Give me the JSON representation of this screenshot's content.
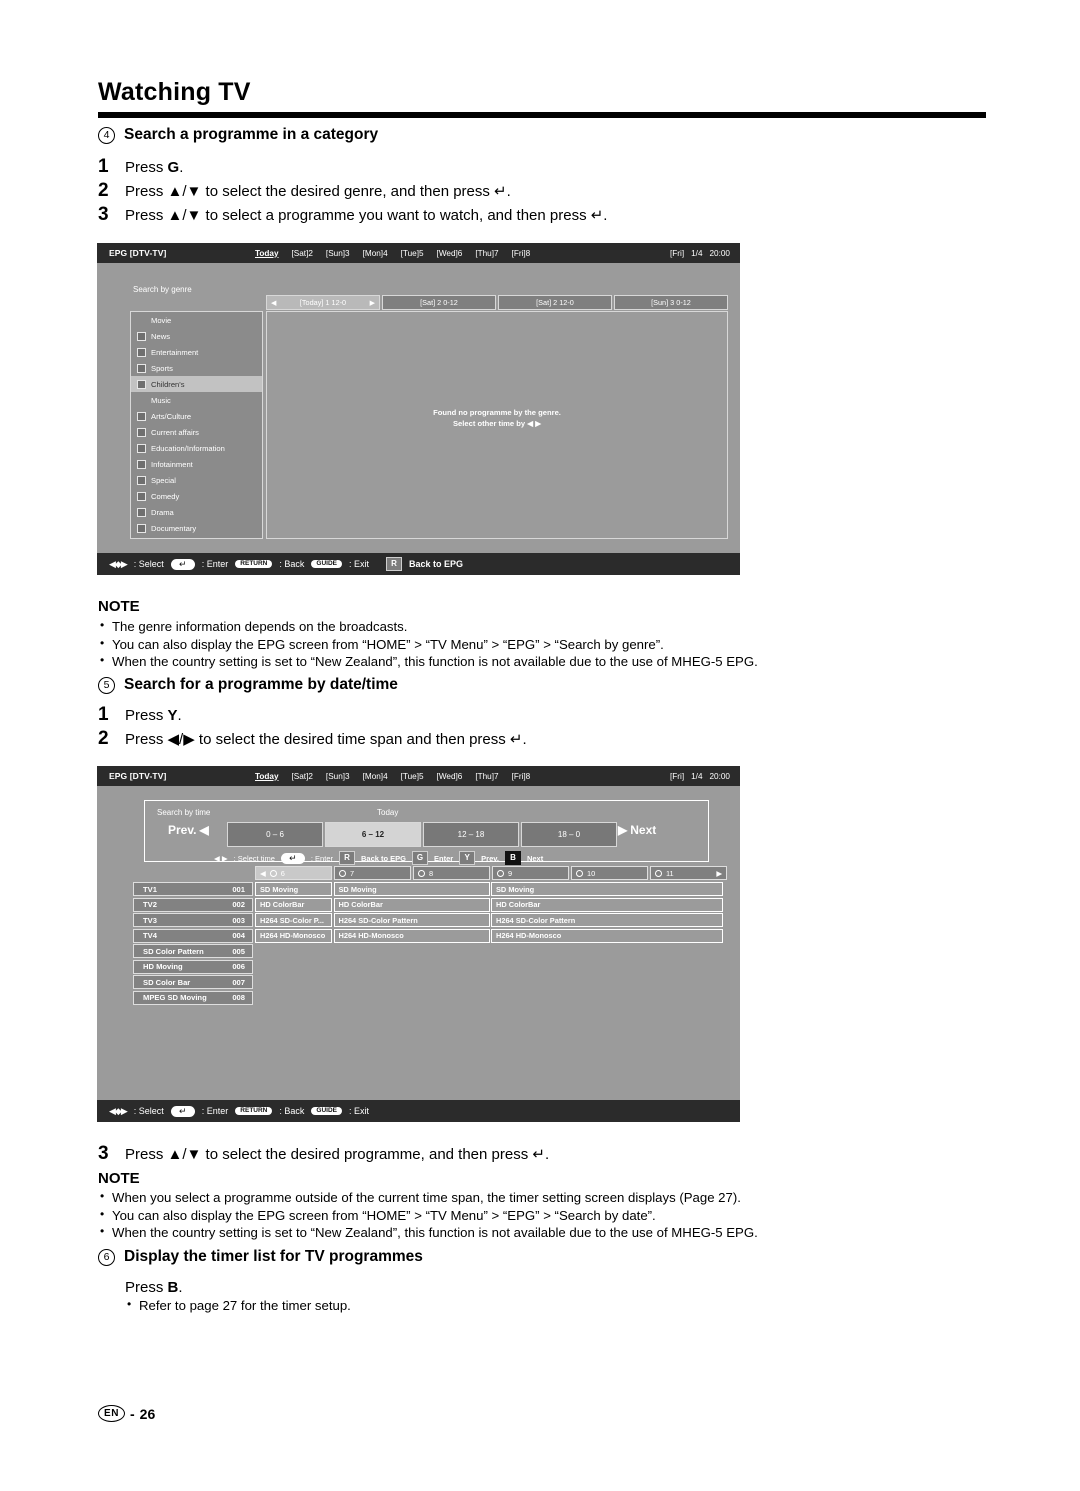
{
  "document": {
    "title": "Watching TV",
    "footer_lang": "EN",
    "footer_sep": "-",
    "footer_page": "26"
  },
  "section4": {
    "number": "4",
    "heading": "Search a programme in a category",
    "steps": [
      {
        "num": "1",
        "text_before": "Press ",
        "bold": "G",
        "text_after": "."
      },
      {
        "num": "2",
        "text_before": "Press ▲/▼ to select the desired genre, and then press ↵.",
        "bold": "",
        "text_after": ""
      },
      {
        "num": "3",
        "text_before": "Press ▲/▼ to select a programme you want to watch, and then press ↵.",
        "bold": "",
        "text_after": ""
      }
    ],
    "note_head": "NOTE",
    "notes": [
      "The genre information depends on the broadcasts.",
      "You can also display the EPG screen from “HOME” > “TV Menu” > “EPG” > “Search by genre”.",
      "When the country setting is set to “New Zealand”, this function is not available due to the use of MHEG-5 EPG."
    ]
  },
  "section5": {
    "number": "5",
    "heading": "Search for a programme by date/time",
    "steps": [
      {
        "num": "1",
        "text_before": "Press ",
        "bold": "Y",
        "text_after": "."
      },
      {
        "num": "2",
        "text_before": "Press ◀/▶ to select the desired time span and then press ↵.",
        "bold": "",
        "text_after": ""
      }
    ],
    "step3": {
      "num": "3",
      "text": "Press ▲/▼ to select the desired programme, and then press ↵."
    },
    "note_head": "NOTE",
    "notes": [
      "When you select a programme outside of the current time span, the timer setting screen displays (Page 27).",
      "You can also display the EPG screen from “HOME” > “TV Menu” > “EPG” > “Search by date”.",
      "When the country setting is set to “New Zealand”, this function is not available due to the use of MHEG-5 EPG."
    ]
  },
  "section6": {
    "number": "6",
    "heading": "Display the timer list for TV programmes",
    "press_before": "Press ",
    "press_bold": "B",
    "press_after": ".",
    "bullet": "Refer to page 27 for the timer setup."
  },
  "epg_common": {
    "brand": "EPG [DTV-TV]",
    "date_tabs": [
      "Today",
      "[Sat]2",
      "[Sun]3",
      "[Mon]4",
      "[Tue]5",
      "[Wed]6",
      "[Thu]7",
      "[Fri]8"
    ],
    "selected_date_tab": "Today",
    "clock_day": "[Fri]",
    "clock_date": "1/4",
    "clock_time": "20:00",
    "footer": {
      "select_label": ": Select",
      "enter_key": "↵",
      "enter_label": ": Enter",
      "return_key": "RETURN",
      "return_label": ": Back",
      "guide_key": "GUIDE",
      "guide_label": ": Exit",
      "red_key": "R",
      "red_label": "Back to EPG"
    }
  },
  "epg_genre": {
    "panel_label": "Search by genre",
    "range_tabs": [
      {
        "label": "[Today] 1 12-0",
        "selected": true
      },
      {
        "label": "[Sat] 2 0-12",
        "selected": false
      },
      {
        "label": "[Sat] 2 12-0",
        "selected": false
      },
      {
        "label": "[Sun] 3 0-12",
        "selected": false
      }
    ],
    "genres": [
      {
        "label": "Movie",
        "icon": "",
        "selected": false
      },
      {
        "label": "News",
        "icon": "news-icon",
        "selected": false
      },
      {
        "label": "Entertainment",
        "icon": "entertainment-icon",
        "selected": false
      },
      {
        "label": "Sports",
        "icon": "sports-icon",
        "selected": false
      },
      {
        "label": "Children's",
        "icon": "children-icon",
        "selected": true
      },
      {
        "label": "Music",
        "icon": "",
        "selected": false
      },
      {
        "label": "Arts/Culture",
        "icon": "arts-icon",
        "selected": false
      },
      {
        "label": "Current affairs",
        "icon": "current-affairs-icon",
        "selected": false
      },
      {
        "label": "Education/Information",
        "icon": "education-icon",
        "selected": false
      },
      {
        "label": "Infotainment",
        "icon": "infotainment-icon",
        "selected": false
      },
      {
        "label": "Special",
        "icon": "special-icon",
        "selected": false
      },
      {
        "label": "Comedy",
        "icon": "comedy-icon",
        "selected": false
      },
      {
        "label": "Drama",
        "icon": "drama-icon",
        "selected": false
      },
      {
        "label": "Documentary",
        "icon": "documentary-icon",
        "selected": false
      }
    ],
    "result_line1": "Found no programme by the genre.",
    "result_line2": "Select other time by ◀ ▶"
  },
  "epg_time": {
    "panel_label": "Search by time",
    "today_label": "Today",
    "prev_label": "Prev.",
    "next_label": "Next",
    "spans": [
      {
        "label": "0 – 6",
        "selected": false
      },
      {
        "label": "6 – 12",
        "selected": true
      },
      {
        "label": "12 – 18",
        "selected": false
      },
      {
        "label": "18 – 0",
        "selected": false
      }
    ],
    "legend": {
      "select_time": ": Select time",
      "enter_key": "↵",
      "enter_label": ": Enter",
      "red_key": "R",
      "red_label": "Back to EPG",
      "green_key": "G",
      "green_label": "Enter",
      "yellow_key": "Y",
      "yellow_label": "Prev.",
      "blue_key": "B",
      "blue_label": "Next"
    },
    "hours": [
      "6",
      "7",
      "8",
      "9",
      "10",
      "11"
    ],
    "channels": [
      {
        "name": "TV1",
        "number": "001"
      },
      {
        "name": "TV2",
        "number": "002"
      },
      {
        "name": "TV3",
        "number": "003"
      },
      {
        "name": "TV4",
        "number": "004"
      },
      {
        "name": "SD Color Pattern",
        "number": "005"
      },
      {
        "name": "HD Moving",
        "number": "006"
      },
      {
        "name": "SD Color Bar",
        "number": "007"
      },
      {
        "name": "MPEG SD Moving",
        "number": "008"
      }
    ],
    "programmes": [
      [
        "SD Moving",
        "SD Moving",
        "SD Moving"
      ],
      [
        "HD ColorBar",
        "HD ColorBar",
        "HD ColorBar"
      ],
      [
        "H264 SD-Color P...",
        "H264 SD-Color Pattern",
        "H264 SD-Color Pattern"
      ],
      [
        "H264 HD-Monosco",
        "H264 HD-Monosco",
        "H264 HD-Monosco"
      ]
    ],
    "footer": {
      "select_label": ": Select",
      "enter_key": "↵",
      "enter_label": ": Enter",
      "return_key": "RETURN",
      "return_label": ": Back",
      "guide_key": "GUIDE",
      "guide_label": ": Exit"
    }
  }
}
